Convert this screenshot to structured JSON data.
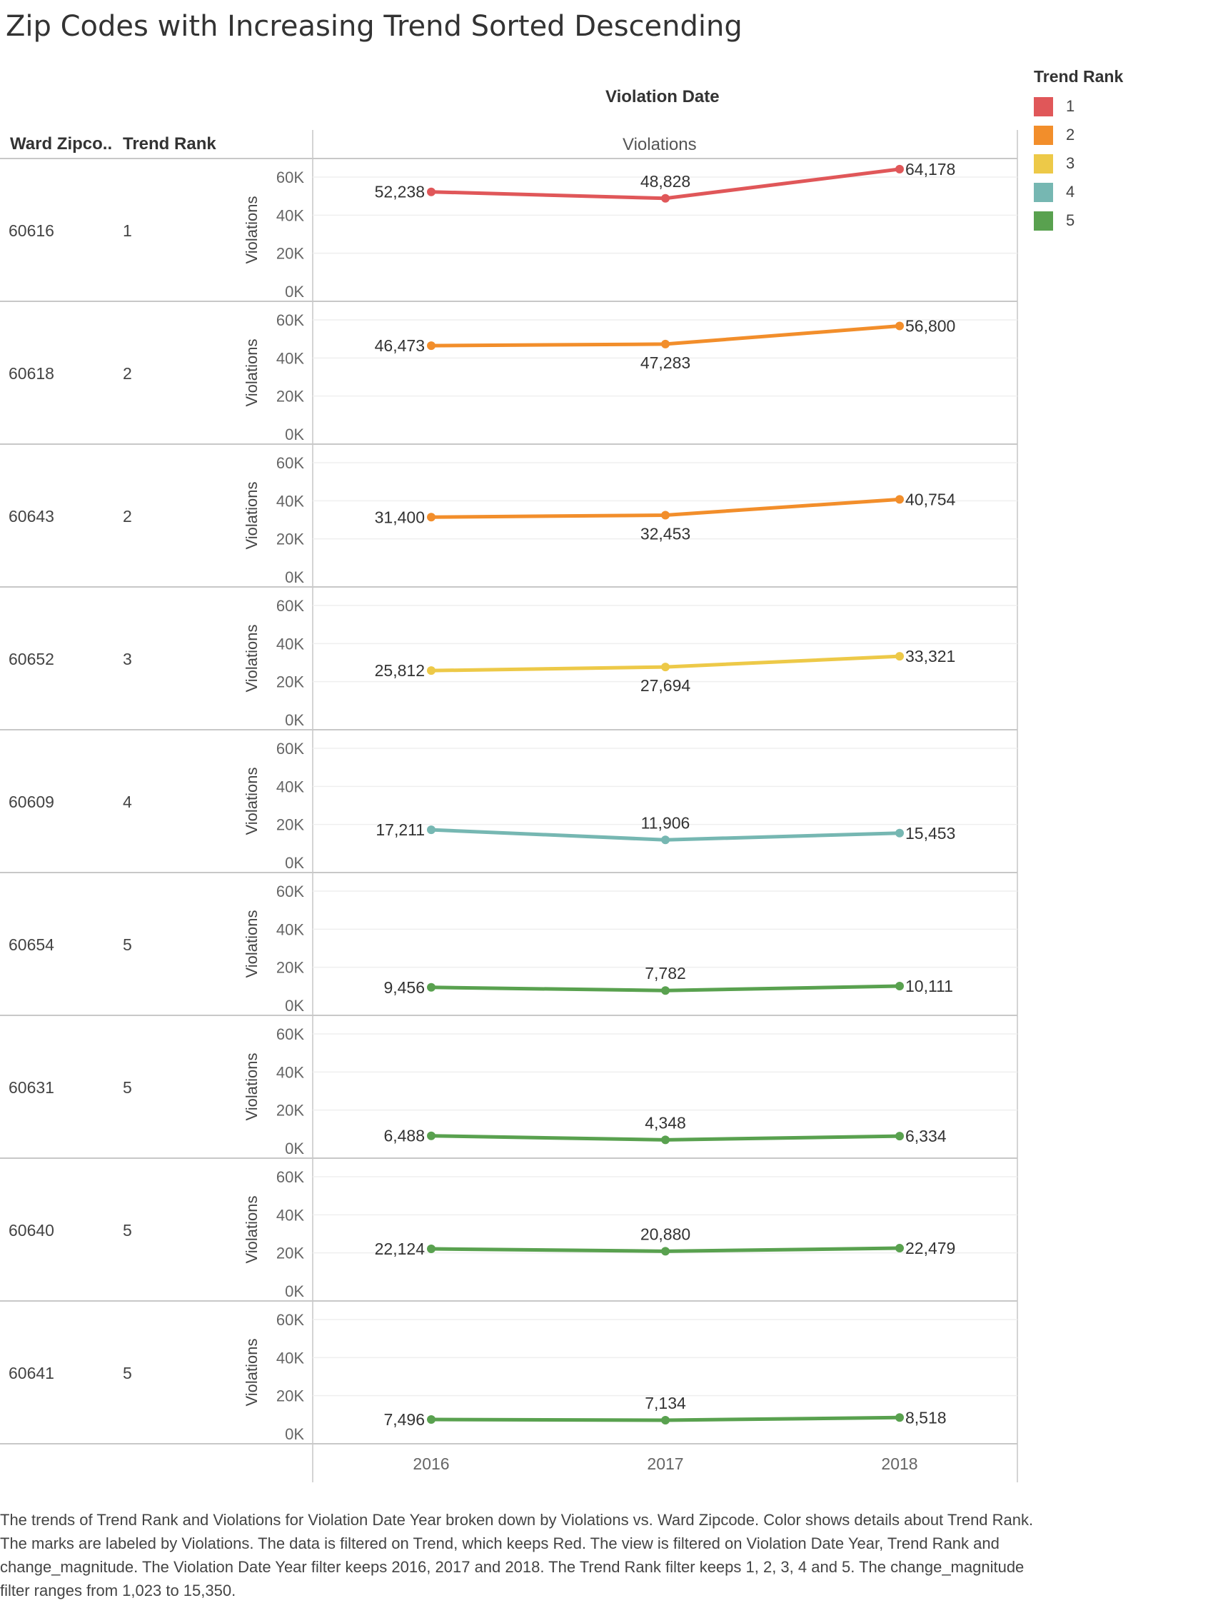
{
  "title": "Zip Codes with Increasing Trend Sorted Descending",
  "headers": {
    "zip": "Ward Zipco..",
    "rank": "Trend Rank",
    "date": "Violation Date",
    "violations": "Violations"
  },
  "legend": {
    "title": "Trend Rank",
    "items": [
      {
        "label": "1",
        "color": "#e05759"
      },
      {
        "label": "2",
        "color": "#f28e2b"
      },
      {
        "label": "3",
        "color": "#edc948"
      },
      {
        "label": "4",
        "color": "#76b7b2"
      },
      {
        "label": "5",
        "color": "#59a14f"
      }
    ]
  },
  "caption": "The trends of Trend Rank and Violations for Violation Date Year broken down by Violations vs. Ward Zipcode.  Color shows details about Trend Rank.  The marks are labeled by Violations. The data is filtered on Trend, which keeps Red. The view is filtered on Violation Date Year, Trend Rank and change_magnitude. The Violation Date Year filter keeps 2016, 2017 and 2018. The Trend Rank filter keeps 1, 2, 3, 4 and 5. The change_magnitude filter ranges from 1,023 to 15,350.",
  "chart_data": {
    "type": "line",
    "x": [
      "2016",
      "2017",
      "2018"
    ],
    "xlabel": "Violation Date",
    "ylabel": "Violations",
    "ylim": [
      0,
      65000
    ],
    "yticks": [
      0,
      20000,
      40000,
      60000
    ],
    "ytick_labels": [
      "0K",
      "20K",
      "40K",
      "60K"
    ],
    "grid": true,
    "legend_position": "top-right",
    "rows": [
      {
        "zip": "60616",
        "rank": "1",
        "color": "#e05759",
        "values": [
          52238,
          48828,
          64178
        ],
        "labels": [
          "52,238",
          "48,828",
          "64,178"
        ]
      },
      {
        "zip": "60618",
        "rank": "2",
        "color": "#f28e2b",
        "values": [
          46473,
          47283,
          56800
        ],
        "labels": [
          "46,473",
          "47,283",
          "56,800"
        ]
      },
      {
        "zip": "60643",
        "rank": "2",
        "color": "#f28e2b",
        "values": [
          31400,
          32453,
          40754
        ],
        "labels": [
          "31,400",
          "32,453",
          "40,754"
        ]
      },
      {
        "zip": "60652",
        "rank": "3",
        "color": "#edc948",
        "values": [
          25812,
          27694,
          33321
        ],
        "labels": [
          "25,812",
          "27,694",
          "33,321"
        ]
      },
      {
        "zip": "60609",
        "rank": "4",
        "color": "#76b7b2",
        "values": [
          17211,
          11906,
          15453
        ],
        "labels": [
          "17,211",
          "11,906",
          "15,453"
        ]
      },
      {
        "zip": "60654",
        "rank": "5",
        "color": "#59a14f",
        "values": [
          9456,
          7782,
          10111
        ],
        "labels": [
          "9,456",
          "7,782",
          "10,111"
        ]
      },
      {
        "zip": "60631",
        "rank": "5",
        "color": "#59a14f",
        "values": [
          6488,
          4348,
          6334
        ],
        "labels": [
          "6,488",
          "4,348",
          "6,334"
        ]
      },
      {
        "zip": "60640",
        "rank": "5",
        "color": "#59a14f",
        "values": [
          22124,
          20880,
          22479
        ],
        "labels": [
          "22,124",
          "20,880",
          "22,479"
        ]
      },
      {
        "zip": "60641",
        "rank": "5",
        "color": "#59a14f",
        "values": [
          7496,
          7134,
          8518
        ],
        "labels": [
          "7,496",
          "7,134",
          "8,518"
        ]
      }
    ]
  }
}
